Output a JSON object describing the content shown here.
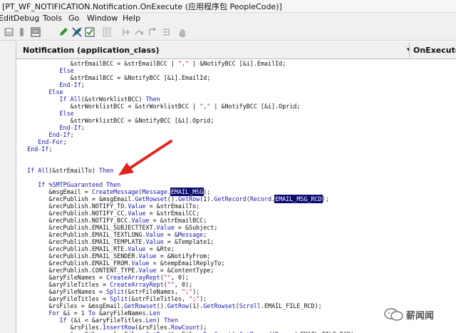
{
  "window": {
    "title": "[PT_WF_NOTIFICATION.Notification.OnExecute (应用程序包 PeopleCode)]"
  },
  "menu": [
    "Edit",
    "Debug",
    "Tools",
    "Go",
    "Window",
    "Help"
  ],
  "toolbar_icons": [
    "save-icon",
    "cut-icon",
    "view-icon",
    "edit-pencil-icon",
    "clear-breakpoint-icon",
    "check-icon",
    "page-icon",
    "step-into-icon",
    "step-over-icon",
    "step-out-icon",
    "run-to-cursor-icon",
    "hand-icon"
  ],
  "editor": {
    "object_name": "Notification   (application_class)",
    "event_name": "OnExecute",
    "dropdown_glyph": "▾"
  },
  "code_lines": [
    "               &strEmailBCC = &strEmailBCC | \",\" | &NotifyBCC [&i].EmailId;",
    "            Else",
    "               &strEmailBCC = &NotifyBCC [&i].EmailId;",
    "            End-If;",
    "         Else",
    "            If All(&strWorklistBCC) Then",
    "               &strWorklistBCC = &strWorklistBCC | \",\" | &NotifyBCC [&i].Oprid;",
    "            Else",
    "               &strWorklistBCC = &NotifyBCC [&i].Oprid;",
    "            End-If;",
    "         End-If;",
    "      End-For;",
    "   End-If;",
    "",
    "",
    "   If All(&strEmailTo) Then",
    "",
    "      If %SMTPGuaranteed Then",
    "         &msgEmail = CreateMessage(Message.EMAIL_MSG);",
    "         &recPublish = &msgEmail.GetRowset().GetRow(1).GetRecord(Record.EMAIL_MSG_RCD);",
    "         &recPublish.NOTIFY_TO.Value = &strEmailTo;",
    "         &recPublish.NOTIFY_CC.Value = &strEmailCC;",
    "         &recPublish.NOTIFY_BCC.Value = &strEmailBCC;",
    "         &recPublish.EMAIL_SUBJECTTEXT.Value = &Subject;",
    "         &recPublish.EMAIL_TEXTLONG.Value = &Message;",
    "         &recPublish.EMAIL_TEMPLATE.Value = &Template1;",
    "         &recPublish.EMAIL_RTE.Value = &Rte;",
    "         &recPublish.EMAIL_SENDER.Value = &NotifyFrom;",
    "         &recPublish.EMAIL_FROM.Value = &tempEmailReplyTo;",
    "         &recPublish.CONTENT_TYPE.Value = &ContentType;",
    "         &aryFileNames = CreateArrayRept(\"\", 0);",
    "         &aryFileTitles = CreateArrayRept(\"\", 0);",
    "         &aryFileNames = Split(&strFileNames, \";\");",
    "         &aryFileTitles = Split(&strFileTitles, \";\");",
    "         &rsFiles = &msgEmail.GetRowset().GetRow(1).GetRowset(Scroll.EMAIL_FILE_RCD);",
    "         For &i = 1 To &aryFileNames.Len",
    "            If (&i < &aryFileTitles.Len) Then",
    "               &rsFiles.InsertRow(&rsFiles.RowCount);",
    "               &recFiles = &rsFiles.GetRow(&rsFiles.RowCount).GetRecord(Record.EMAIL_FILE_RCD);"
  ],
  "highlight_word": "EMAIL_MSG",
  "watermark": {
    "text": "薪闻闻"
  },
  "colors": {
    "keyword": "#1717ae",
    "string": "#b2117f",
    "highlight_bg": "#0b0b6f",
    "arrow": "#e0261c"
  }
}
